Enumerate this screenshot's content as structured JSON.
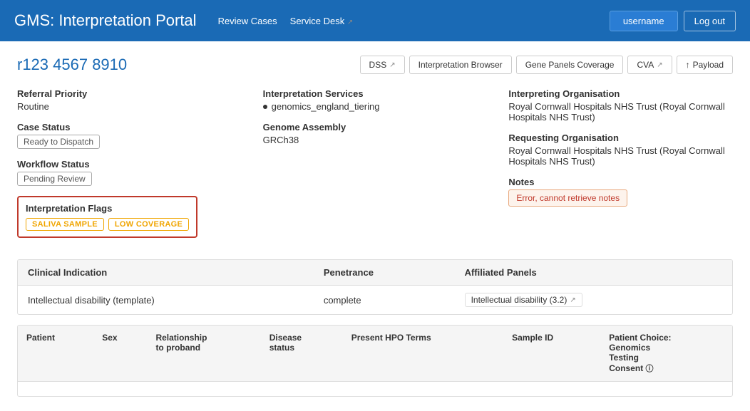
{
  "header": {
    "title": "GMS: Interpretation Portal",
    "nav": [
      {
        "label": "Review Cases",
        "external": false
      },
      {
        "label": "Service Desk",
        "external": true
      }
    ],
    "username_label": "username",
    "logout_label": "Log out"
  },
  "case": {
    "id": "r123 4567 8910",
    "toolbar": [
      {
        "label": "DSS",
        "external": true
      },
      {
        "label": "Interpretation Browser",
        "external": false
      },
      {
        "label": "Gene Panels Coverage",
        "external": false
      },
      {
        "label": "CVA",
        "external": true
      },
      {
        "label": "Payload",
        "external": false,
        "icon": "upload"
      }
    ]
  },
  "referral": {
    "priority_label": "Referral Priority",
    "priority_value": "Routine",
    "case_status_label": "Case Status",
    "case_status_value": "Ready to Dispatch",
    "workflow_status_label": "Workflow Status",
    "workflow_status_value": "Pending Review",
    "flags_label": "Interpretation Flags",
    "flags": [
      {
        "label": "SALIVA SAMPLE"
      },
      {
        "label": "LOW COVERAGE"
      }
    ]
  },
  "interpretation": {
    "services_label": "Interpretation Services",
    "services": [
      "genomics_england_tiering"
    ],
    "genome_assembly_label": "Genome Assembly",
    "genome_assembly_value": "GRCh38"
  },
  "organisation": {
    "interpreting_label": "Interpreting Organisation",
    "interpreting_value": "Royal Cornwall Hospitals NHS Trust (Royal Cornwall Hospitals NHS Trust)",
    "requesting_label": "Requesting Organisation",
    "requesting_value": "Royal Cornwall Hospitals NHS Trust (Royal Cornwall Hospitals NHS Trust)",
    "notes_label": "Notes",
    "notes_error": "Error, cannot retrieve notes"
  },
  "clinical_table": {
    "headers": [
      "Clinical Indication",
      "Penetrance",
      "Affiliated Panels"
    ],
    "rows": [
      {
        "clinical_indication": "Intellectual disability (template)",
        "penetrance": "complete",
        "affiliated_panels": "Intellectual disability (3.2)"
      }
    ]
  },
  "patient_table": {
    "headers": [
      "Patient",
      "Sex",
      "Relationship to proband",
      "Disease status",
      "Present HPO Terms",
      "Sample ID",
      "Patient Choice: Genomics Testing Consent"
    ],
    "rows": []
  }
}
